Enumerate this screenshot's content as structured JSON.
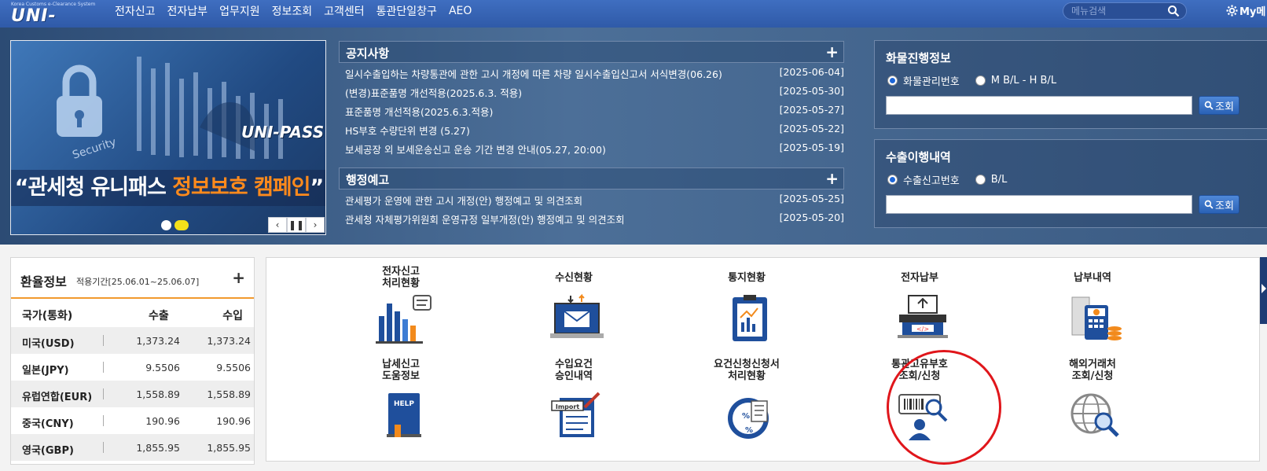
{
  "header": {
    "logo_tagline": "Korea Customs e-Clearance System",
    "logo_word": "UNI-PASS",
    "nav": [
      "전자신고",
      "전자납부",
      "업무지원",
      "정보조회",
      "고객센터",
      "통관단일창구",
      "AEO"
    ],
    "search_placeholder": "메뉴검색",
    "my_label": "My메"
  },
  "banner": {
    "brand": "UNI-PASS",
    "campaign_prefix": "“관세청 유니패스 ",
    "campaign_highlight": "정보보호 캠페인",
    "campaign_suffix": "”",
    "controls": [
      "‹",
      "❚❚",
      "›"
    ]
  },
  "notices": {
    "title": "공지사항",
    "items": [
      {
        "text": "일시수출입하는 차량통관에 관한 고시 개정에 따른 차량 일시수출입신고서 서식변경(06.26)",
        "date": "[2025-06-04]"
      },
      {
        "text": "(변경)표준품명 개선적용(2025.6.3. 적용)",
        "date": "[2025-05-30]"
      },
      {
        "text": "표준품명 개선적용(2025.6.3.적용)",
        "date": "[2025-05-27]"
      },
      {
        "text": "HS부호 수량단위 변경 (5.27)",
        "date": "[2025-05-22]"
      },
      {
        "text": "보세공장 외 보세운송신고 운송 기간 변경 안내(05.27, 20:00)",
        "date": "[2025-05-19]"
      }
    ]
  },
  "admin_notices": {
    "title": "행정예고",
    "items": [
      {
        "text": "관세평가 운영에 관한 고시 개정(안) 행정예고 및 의견조회",
        "date": "[2025-05-25]"
      },
      {
        "text": "관세청 자체평가위원회 운영규정 일부개정(안) 행정예고 및 의견조회",
        "date": "[2025-05-20]"
      }
    ]
  },
  "cargo": {
    "title": "화물진행정보",
    "options": [
      "화물관리번호",
      "M B/L - H B/L"
    ],
    "selected": 0,
    "button": "조회"
  },
  "export": {
    "title": "수출이행내역",
    "options": [
      "수출신고번호",
      "B/L"
    ],
    "selected": 0,
    "button": "조회"
  },
  "fx": {
    "title": "환율정보",
    "period": "적용기간[25.06.01~25.06.07]",
    "columns": [
      "국가(통화)",
      "수출",
      "수입"
    ],
    "rows": [
      {
        "country": "미국(USD)",
        "export": "1,373.24",
        "import": "1,373.24"
      },
      {
        "country": "일본(JPY)",
        "export": "9.5506",
        "import": "9.5506"
      },
      {
        "country": "유럽연합(EUR)",
        "export": "1,558.89",
        "import": "1,558.89"
      },
      {
        "country": "중국(CNY)",
        "export": "190.96",
        "import": "190.96"
      },
      {
        "country": "영국(GBP)",
        "export": "1,855.95",
        "import": "1,855.95"
      }
    ]
  },
  "services": [
    {
      "label": "전자신고\n처리현황",
      "icon": "bar-chart-icon"
    },
    {
      "label": "수신현황",
      "icon": "mail-laptop-icon"
    },
    {
      "label": "통지현황",
      "icon": "clipboard-chart-icon"
    },
    {
      "label": "전자납부",
      "icon": "payment-terminal-icon"
    },
    {
      "label": "납부내역",
      "icon": "receipt-card-icon"
    },
    {
      "label": "납세신고\n도움정보",
      "icon": "help-book-icon"
    },
    {
      "label": "수입요건\n승인내역",
      "icon": "import-document-icon"
    },
    {
      "label": "요건신청신청서\n처리현황",
      "icon": "percent-document-icon"
    },
    {
      "label": "통관고유부호\n조회/신청",
      "icon": "barcode-person-icon"
    },
    {
      "label": "해외거래처\n조회/신청",
      "icon": "globe-search-icon"
    }
  ],
  "colors": {
    "nav": "#3566b8",
    "accent": "#f29a2e",
    "highlight": "#e0161b",
    "campaign_highlight": "#ff8a1c"
  }
}
